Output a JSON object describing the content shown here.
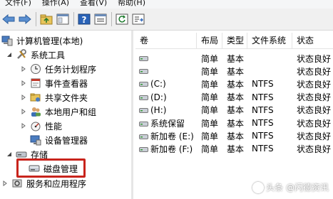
{
  "menu": [
    "文件(F)",
    "操作(A)",
    "查看(V)",
    "帮助(H)"
  ],
  "toolbar": {
    "buttons": [
      "back-icon",
      "forward-icon",
      "up-folder-icon",
      "show-hide-tree-icon",
      "help-icon",
      "properties-icon",
      "refresh-icon",
      "export-list-icon"
    ]
  },
  "tree": {
    "root": "计算机管理(本地)",
    "system_tools": "系统工具",
    "task_scheduler": "任务计划程序",
    "event_viewer": "事件查看器",
    "shared_folders": "共享文件夹",
    "local_users": "本地用户和组",
    "performance": "性能",
    "device_manager": "设备管理器",
    "storage": "存储",
    "disk_management": "磁盘管理",
    "services_apps": "服务和应用程序"
  },
  "list": {
    "headers": {
      "volume": "卷",
      "layout": "布局",
      "type": "类型",
      "fs": "文件系统",
      "status": "状态"
    },
    "rows": [
      {
        "volume": "",
        "layout": "简单",
        "type": "基本",
        "fs": "",
        "status": "状态良好"
      },
      {
        "volume": "",
        "layout": "简单",
        "type": "基本",
        "fs": "",
        "status": "状态良好"
      },
      {
        "volume": "(C:)",
        "layout": "简单",
        "type": "基本",
        "fs": "NTFS",
        "status": "状态良好"
      },
      {
        "volume": "(D:)",
        "layout": "简单",
        "type": "基本",
        "fs": "NTFS",
        "status": "状态良好"
      },
      {
        "volume": "(H:)",
        "layout": "简单",
        "type": "基本",
        "fs": "NTFS",
        "status": "状态良好"
      },
      {
        "volume": "系统保留",
        "layout": "简单",
        "type": "基本",
        "fs": "NTFS",
        "status": "状态良好"
      },
      {
        "volume": "新加卷 (E:)",
        "layout": "简单",
        "type": "基本",
        "fs": "NTFS",
        "status": "状态良好"
      },
      {
        "volume": "新加卷 (F:)",
        "layout": "简单",
        "type": "基本",
        "fs": "NTFS",
        "status": "状态良好"
      }
    ]
  },
  "watermark": {
    "text": "头条 @闪德资讯"
  },
  "colors": {
    "highlight": "#c8241c",
    "toolbar_bg": "#f0f0f0"
  }
}
